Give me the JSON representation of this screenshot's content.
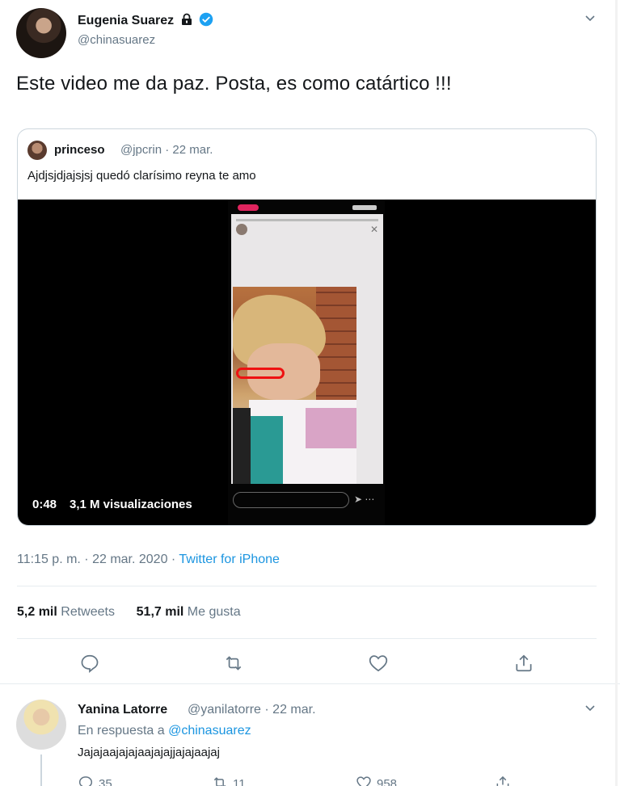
{
  "tweet": {
    "author_name": "Eugenia Suarez",
    "author_handle": "@chinasuarez",
    "text": "Este video me da paz. Posta, es como catártico !!!",
    "timestamp": "11:15 p. m. · 22 mar. 2020 · ",
    "source": "Twitter for iPhone",
    "retweets_count": "5,2 mil",
    "retweets_label": "Retweets",
    "likes_count": "51,7 mil",
    "likes_label": "Me gusta"
  },
  "quoted": {
    "author_name": "princeso",
    "author_handle_date": "@jpcrin · 22 mar.",
    "text": "Ajdjsjdjajsjsj quedó clarísimo reyna te amo",
    "video_duration": "0:48",
    "video_views": "3,1 M visualizaciones"
  },
  "reply": {
    "author_name": "Yanina Latorre",
    "author_handle_date": "@yanilatorre · 22 mar.",
    "in_reply_prefix": "En respuesta a ",
    "in_reply_to": "@chinasuarez",
    "text": "Jajajaajajajaajajajjajajaajaj",
    "replies": "35",
    "retweets": "11",
    "likes": "958"
  },
  "colors": {
    "link": "#1b95e0",
    "verified": "#1da1f2",
    "secondary_text": "#657786"
  },
  "icons": [
    "lock-icon",
    "verified-badge-icon",
    "chevron-down-icon",
    "reply-icon",
    "retweet-icon",
    "like-icon",
    "share-icon"
  ]
}
